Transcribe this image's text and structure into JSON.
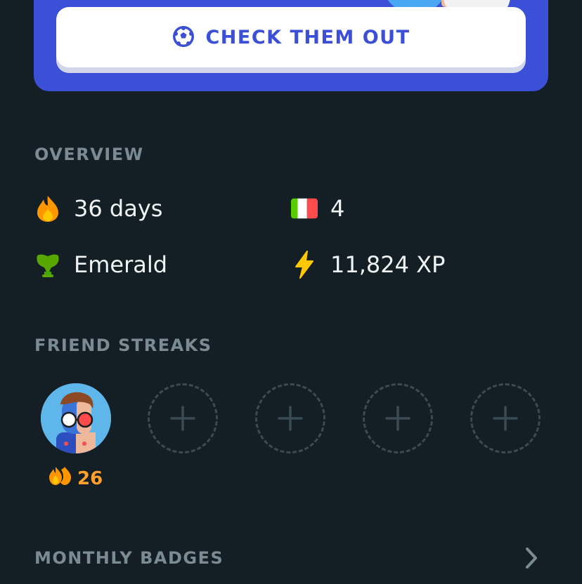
{
  "promo": {
    "cta_label": "CHECK THEM OUT",
    "cta_icon": "soccer-ball-icon",
    "background_color": "#3b50d6"
  },
  "overview": {
    "title": "OVERVIEW",
    "stats": [
      {
        "icon": "flame-icon",
        "value": "36 days"
      },
      {
        "icon": "italy-flag-icon",
        "value": "4"
      },
      {
        "icon": "emerald-trophy-icon",
        "value": "Emerald"
      },
      {
        "icon": "lightning-icon",
        "value": "11,824 XP"
      }
    ]
  },
  "friend_streaks": {
    "title": "FRIEND STREAKS",
    "friends": [
      {
        "icon": "friend-avatar",
        "streak": "26",
        "streak_icon": "double-flame-icon"
      }
    ],
    "empty_slots": 4,
    "add_icon": "plus-icon"
  },
  "monthly_badges": {
    "title": "MONTHLY BADGES",
    "icon": "chevron-right-icon"
  },
  "colors": {
    "background": "#131f24",
    "accent_blue": "#3b50d6",
    "flame_orange": "#ff9f2e",
    "xp_yellow": "#ffc800",
    "emerald_green": "#58a700",
    "section_gray": "#7a8b93"
  }
}
